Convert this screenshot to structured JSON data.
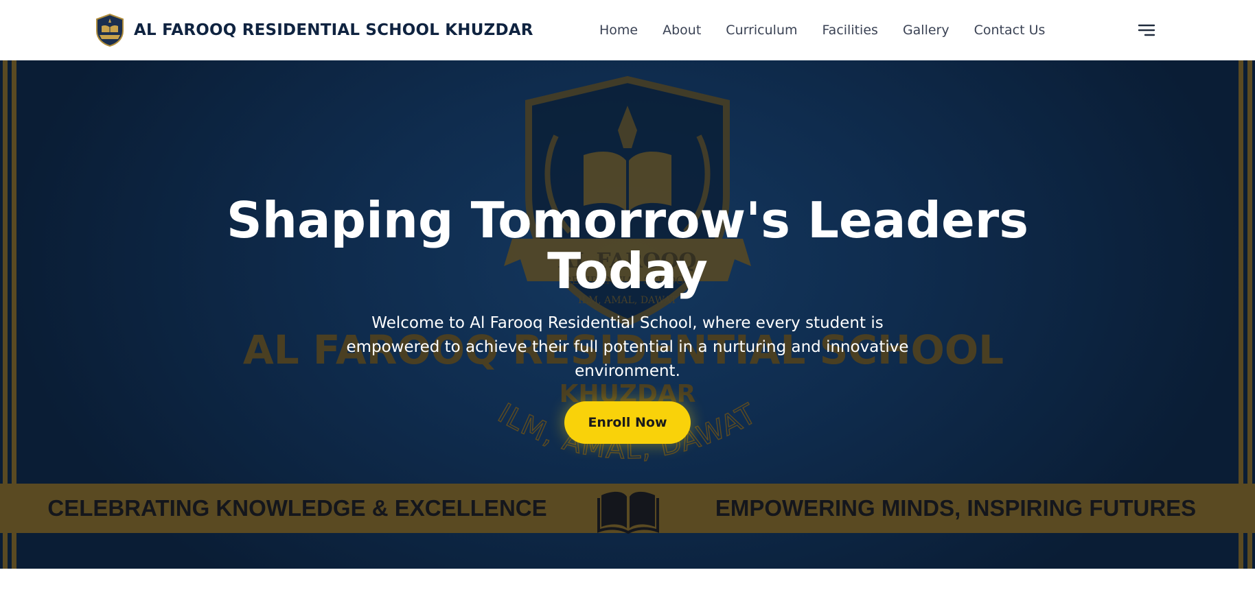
{
  "brand": {
    "name": "AL FAROOQ RESIDENTIAL SCHOOL KHUZDAR",
    "logo_icon": "school-crest-icon"
  },
  "nav": {
    "items": [
      {
        "label": "Home"
      },
      {
        "label": "About"
      },
      {
        "label": "Curriculum"
      },
      {
        "label": "Facilities"
      },
      {
        "label": "Gallery"
      },
      {
        "label": "Contact Us"
      }
    ],
    "menu_icon": "hamburger-menu-icon"
  },
  "hero": {
    "title": "Shaping Tomorrow's Leaders Today",
    "subtitle": "Welcome to Al Farooq Residential School, where every student is empowered to achieve their full potential in a nurturing and innovative environment.",
    "cta_label": "Enroll Now",
    "background": {
      "crest_banner_text": "AL FAROOQ",
      "crest_banner_subtext": "RESIDENTIAL SCHOOL",
      "crest_motto": "ILM, AMAL, DAWAT",
      "school_name_line1": "AL FAROOQ RESIDENTIAL SCHOOL",
      "school_name_line2": "KHUZDAR",
      "arc_motto": "ILM, AMAL, DAWAT",
      "band_left_text": "CELEBRATING KNOWLEDGE & EXCELLENCE",
      "band_right_text": "EMPOWERING MINDS, INSPIRING FUTURES",
      "band_icon": "open-book-icon"
    }
  },
  "colors": {
    "navy": "#0f2340",
    "hero_bg": "#0f2c4e",
    "gold": "#5a4a22",
    "accent_yellow": "#f9d20a",
    "nav_text": "#3a4254"
  }
}
